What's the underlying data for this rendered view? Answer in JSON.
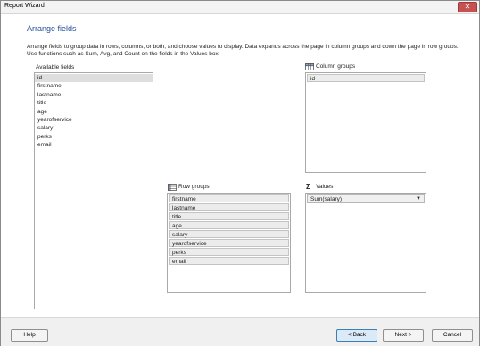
{
  "window": {
    "title": "Report Wizard",
    "close_glyph": "✕"
  },
  "page": {
    "heading": "Arrange fields",
    "description": "Arrange fields to group data in rows, columns, or both, and choose values to display. Data expands across the page in column groups and down the page in row groups.  Use functions such as Sum, Avg, and Count on the fields in the Values box."
  },
  "available_fields": {
    "label": "Available fields",
    "items": [
      "id",
      "firstname",
      "lastname",
      "title",
      "age",
      "yearofservice",
      "salary",
      "perks",
      "email"
    ],
    "selected_index": 0
  },
  "column_groups": {
    "label": "Column groups",
    "icon": "column-groups-icon",
    "items": [
      "id"
    ]
  },
  "row_groups": {
    "label": "Row groups",
    "icon": "row-groups-icon",
    "items": [
      "firstname",
      "lastname",
      "title",
      "age",
      "salary",
      "yearofservice",
      "perks",
      "email"
    ]
  },
  "values": {
    "label": "Values",
    "icon_glyph": "Σ",
    "icon": "sigma-icon",
    "selected": "Sum(salary)",
    "arrow_glyph": "▼"
  },
  "buttons": {
    "help": "Help",
    "back": "< Back",
    "next": "Next >",
    "cancel": "Cancel"
  }
}
